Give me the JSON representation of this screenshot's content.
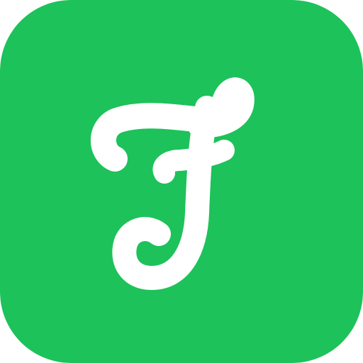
{
  "app_icon": {
    "icon": "script-f-logo-icon",
    "background_color": "#1DC25A",
    "glyph_color": "#FFFFFF"
  }
}
